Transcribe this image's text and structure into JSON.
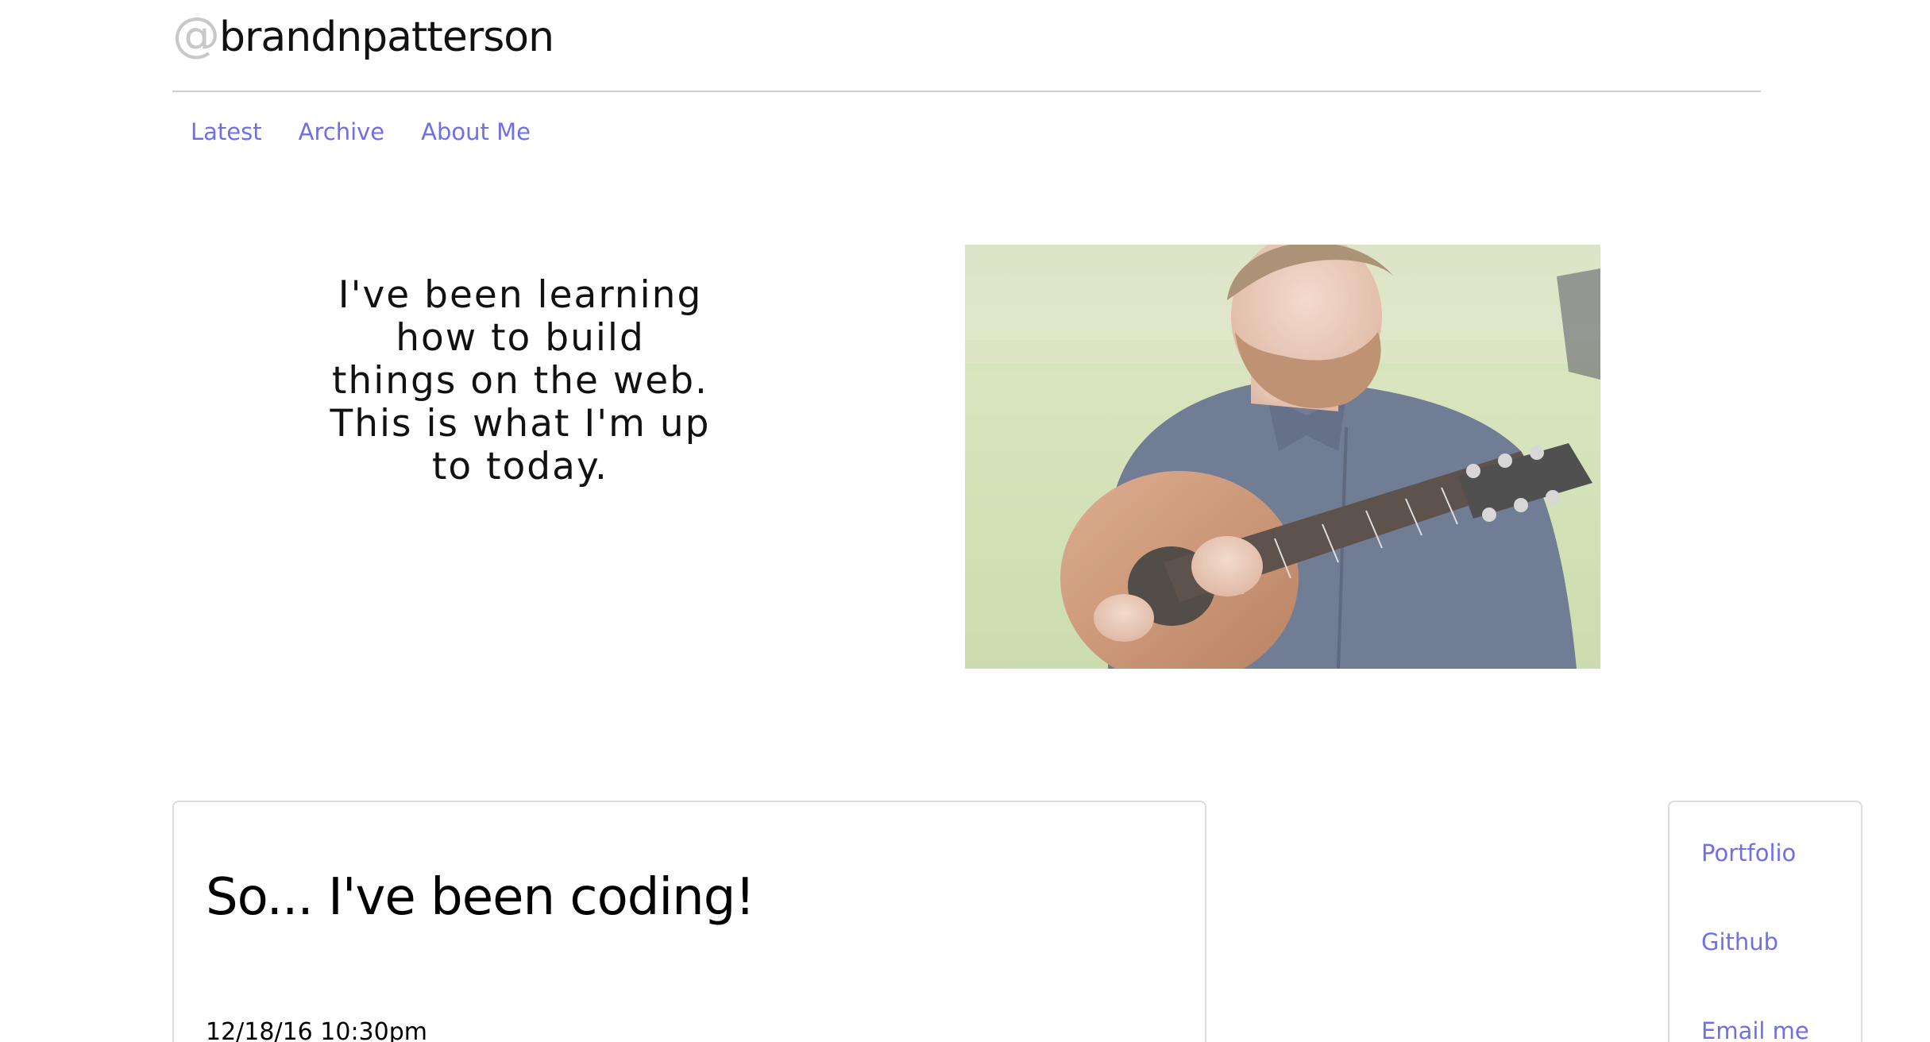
{
  "header": {
    "at_symbol": "@",
    "handle": "brandnpatterson"
  },
  "nav": {
    "items": [
      {
        "label": "Latest"
      },
      {
        "label": "Archive"
      },
      {
        "label": "About Me"
      }
    ]
  },
  "hero": {
    "lines": [
      "I've been learning",
      "how to build",
      "things on the web.",
      "This is what I'm up",
      "to today."
    ]
  },
  "post": {
    "title": "So... I've been coding!",
    "date": "12/18/16 10:30pm"
  },
  "sidebar": {
    "links": [
      {
        "label": "Portfolio"
      },
      {
        "label": "Github"
      },
      {
        "label": "Email me"
      }
    ]
  },
  "colors": {
    "link": "#6f6fe6",
    "rule": "#cfcfcf",
    "at_symbol": "#c8c8c8",
    "card_border": "#dcdcdc"
  }
}
